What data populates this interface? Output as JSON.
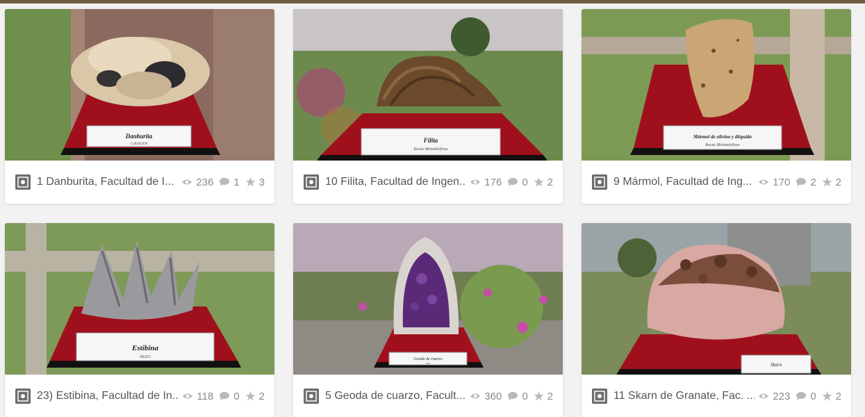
{
  "colors": {
    "background": "#f2f2f2",
    "top_bar": "#6b5e3f",
    "card": "#ffffff",
    "title_text": "#555555",
    "stat_text": "#8a8a8a",
    "stand_red": "#a0101c"
  },
  "icons": {
    "avatar": "unam-logo-icon",
    "views": "eye-icon",
    "comments": "comment-icon",
    "likes": "star-icon"
  },
  "models": [
    {
      "title": "1 Danburita, Facultad de I...",
      "views": "236",
      "comments": "1",
      "likes": "3",
      "label_name": "Danburita",
      "label_formula": "CaB2Si2O8"
    },
    {
      "title": "10 Filita, Facultad de Ingen...",
      "views": "176",
      "comments": "0",
      "likes": "2",
      "label_name": "Filita",
      "label_formula": "Rocas Metamórficas"
    },
    {
      "title": "9 Mármol, Facultad de Ing...",
      "views": "170",
      "comments": "2",
      "likes": "2",
      "label_name": "Mármol de olivino y diópsido",
      "label_formula": "Rocas Metamórficas"
    },
    {
      "title": "23) Estibina, Facultad de In...",
      "views": "118",
      "comments": "0",
      "likes": "2",
      "label_name": "Estibina",
      "label_formula": "Sb2S3"
    },
    {
      "title": "5 Geoda de cuarzo, Facult...",
      "views": "360",
      "comments": "0",
      "likes": "2",
      "label_name": "Geoda de cuarzo",
      "label_formula": "SiO2"
    },
    {
      "title": "11 Skarn de Granate, Fac. ...",
      "views": "223",
      "comments": "0",
      "likes": "2",
      "label_name": "Skarn",
      "label_formula": ""
    }
  ]
}
